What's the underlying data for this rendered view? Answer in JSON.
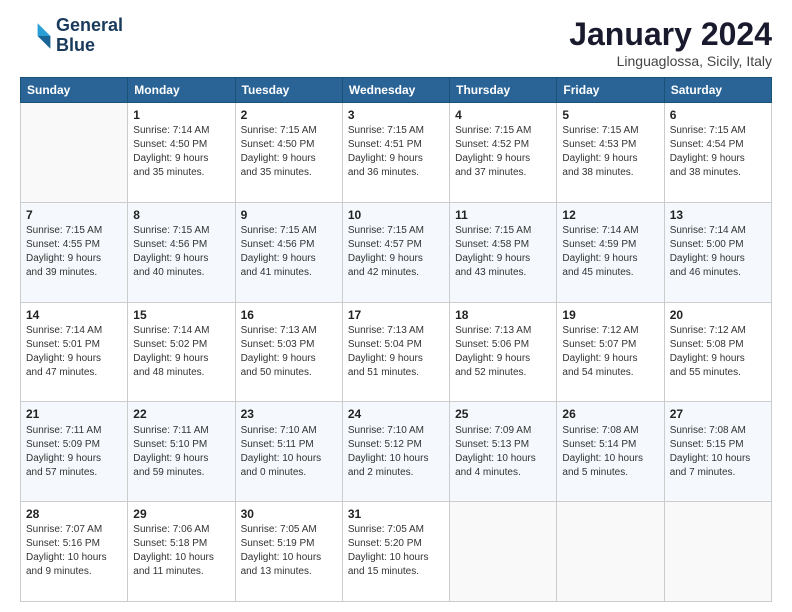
{
  "logo": {
    "line1": "General",
    "line2": "Blue"
  },
  "title": "January 2024",
  "subtitle": "Linguaglossa, Sicily, Italy",
  "days_of_week": [
    "Sunday",
    "Monday",
    "Tuesday",
    "Wednesday",
    "Thursday",
    "Friday",
    "Saturday"
  ],
  "weeks": [
    [
      {
        "day": "",
        "info": ""
      },
      {
        "day": "1",
        "info": "Sunrise: 7:14 AM\nSunset: 4:50 PM\nDaylight: 9 hours\nand 35 minutes."
      },
      {
        "day": "2",
        "info": "Sunrise: 7:15 AM\nSunset: 4:50 PM\nDaylight: 9 hours\nand 35 minutes."
      },
      {
        "day": "3",
        "info": "Sunrise: 7:15 AM\nSunset: 4:51 PM\nDaylight: 9 hours\nand 36 minutes."
      },
      {
        "day": "4",
        "info": "Sunrise: 7:15 AM\nSunset: 4:52 PM\nDaylight: 9 hours\nand 37 minutes."
      },
      {
        "day": "5",
        "info": "Sunrise: 7:15 AM\nSunset: 4:53 PM\nDaylight: 9 hours\nand 38 minutes."
      },
      {
        "day": "6",
        "info": "Sunrise: 7:15 AM\nSunset: 4:54 PM\nDaylight: 9 hours\nand 38 minutes."
      }
    ],
    [
      {
        "day": "7",
        "info": "Sunrise: 7:15 AM\nSunset: 4:55 PM\nDaylight: 9 hours\nand 39 minutes."
      },
      {
        "day": "8",
        "info": "Sunrise: 7:15 AM\nSunset: 4:56 PM\nDaylight: 9 hours\nand 40 minutes."
      },
      {
        "day": "9",
        "info": "Sunrise: 7:15 AM\nSunset: 4:56 PM\nDaylight: 9 hours\nand 41 minutes."
      },
      {
        "day": "10",
        "info": "Sunrise: 7:15 AM\nSunset: 4:57 PM\nDaylight: 9 hours\nand 42 minutes."
      },
      {
        "day": "11",
        "info": "Sunrise: 7:15 AM\nSunset: 4:58 PM\nDaylight: 9 hours\nand 43 minutes."
      },
      {
        "day": "12",
        "info": "Sunrise: 7:14 AM\nSunset: 4:59 PM\nDaylight: 9 hours\nand 45 minutes."
      },
      {
        "day": "13",
        "info": "Sunrise: 7:14 AM\nSunset: 5:00 PM\nDaylight: 9 hours\nand 46 minutes."
      }
    ],
    [
      {
        "day": "14",
        "info": "Sunrise: 7:14 AM\nSunset: 5:01 PM\nDaylight: 9 hours\nand 47 minutes."
      },
      {
        "day": "15",
        "info": "Sunrise: 7:14 AM\nSunset: 5:02 PM\nDaylight: 9 hours\nand 48 minutes."
      },
      {
        "day": "16",
        "info": "Sunrise: 7:13 AM\nSunset: 5:03 PM\nDaylight: 9 hours\nand 50 minutes."
      },
      {
        "day": "17",
        "info": "Sunrise: 7:13 AM\nSunset: 5:04 PM\nDaylight: 9 hours\nand 51 minutes."
      },
      {
        "day": "18",
        "info": "Sunrise: 7:13 AM\nSunset: 5:06 PM\nDaylight: 9 hours\nand 52 minutes."
      },
      {
        "day": "19",
        "info": "Sunrise: 7:12 AM\nSunset: 5:07 PM\nDaylight: 9 hours\nand 54 minutes."
      },
      {
        "day": "20",
        "info": "Sunrise: 7:12 AM\nSunset: 5:08 PM\nDaylight: 9 hours\nand 55 minutes."
      }
    ],
    [
      {
        "day": "21",
        "info": "Sunrise: 7:11 AM\nSunset: 5:09 PM\nDaylight: 9 hours\nand 57 minutes."
      },
      {
        "day": "22",
        "info": "Sunrise: 7:11 AM\nSunset: 5:10 PM\nDaylight: 9 hours\nand 59 minutes."
      },
      {
        "day": "23",
        "info": "Sunrise: 7:10 AM\nSunset: 5:11 PM\nDaylight: 10 hours\nand 0 minutes."
      },
      {
        "day": "24",
        "info": "Sunrise: 7:10 AM\nSunset: 5:12 PM\nDaylight: 10 hours\nand 2 minutes."
      },
      {
        "day": "25",
        "info": "Sunrise: 7:09 AM\nSunset: 5:13 PM\nDaylight: 10 hours\nand 4 minutes."
      },
      {
        "day": "26",
        "info": "Sunrise: 7:08 AM\nSunset: 5:14 PM\nDaylight: 10 hours\nand 5 minutes."
      },
      {
        "day": "27",
        "info": "Sunrise: 7:08 AM\nSunset: 5:15 PM\nDaylight: 10 hours\nand 7 minutes."
      }
    ],
    [
      {
        "day": "28",
        "info": "Sunrise: 7:07 AM\nSunset: 5:16 PM\nDaylight: 10 hours\nand 9 minutes."
      },
      {
        "day": "29",
        "info": "Sunrise: 7:06 AM\nSunset: 5:18 PM\nDaylight: 10 hours\nand 11 minutes."
      },
      {
        "day": "30",
        "info": "Sunrise: 7:05 AM\nSunset: 5:19 PM\nDaylight: 10 hours\nand 13 minutes."
      },
      {
        "day": "31",
        "info": "Sunrise: 7:05 AM\nSunset: 5:20 PM\nDaylight: 10 hours\nand 15 minutes."
      },
      {
        "day": "",
        "info": ""
      },
      {
        "day": "",
        "info": ""
      },
      {
        "day": "",
        "info": ""
      }
    ]
  ]
}
